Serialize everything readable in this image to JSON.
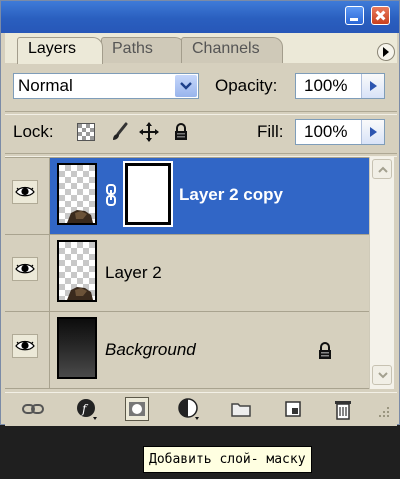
{
  "panel": {
    "tabs": [
      {
        "label": "Layers",
        "active": true
      },
      {
        "label": "Paths",
        "active": false
      },
      {
        "label": "Channels",
        "active": false
      }
    ]
  },
  "blend": {
    "mode": "Normal"
  },
  "opacity": {
    "label": "Opacity:",
    "value": "100%"
  },
  "lock": {
    "label": "Lock:"
  },
  "fill": {
    "label": "Fill:",
    "value": "100%"
  },
  "layers": [
    {
      "name": "Layer 2 copy",
      "selected": true,
      "visible": true,
      "has_mask": true
    },
    {
      "name": "Layer 2",
      "selected": false,
      "visible": true,
      "has_mask": false
    },
    {
      "name": "Background",
      "selected": false,
      "visible": true,
      "locked": true
    }
  ],
  "tooltip": {
    "text": "Добавить слой- маску"
  },
  "colors": {
    "selection": "#3166c6",
    "panel": "#d6d0be",
    "titlebar": "#2a5fbf"
  }
}
